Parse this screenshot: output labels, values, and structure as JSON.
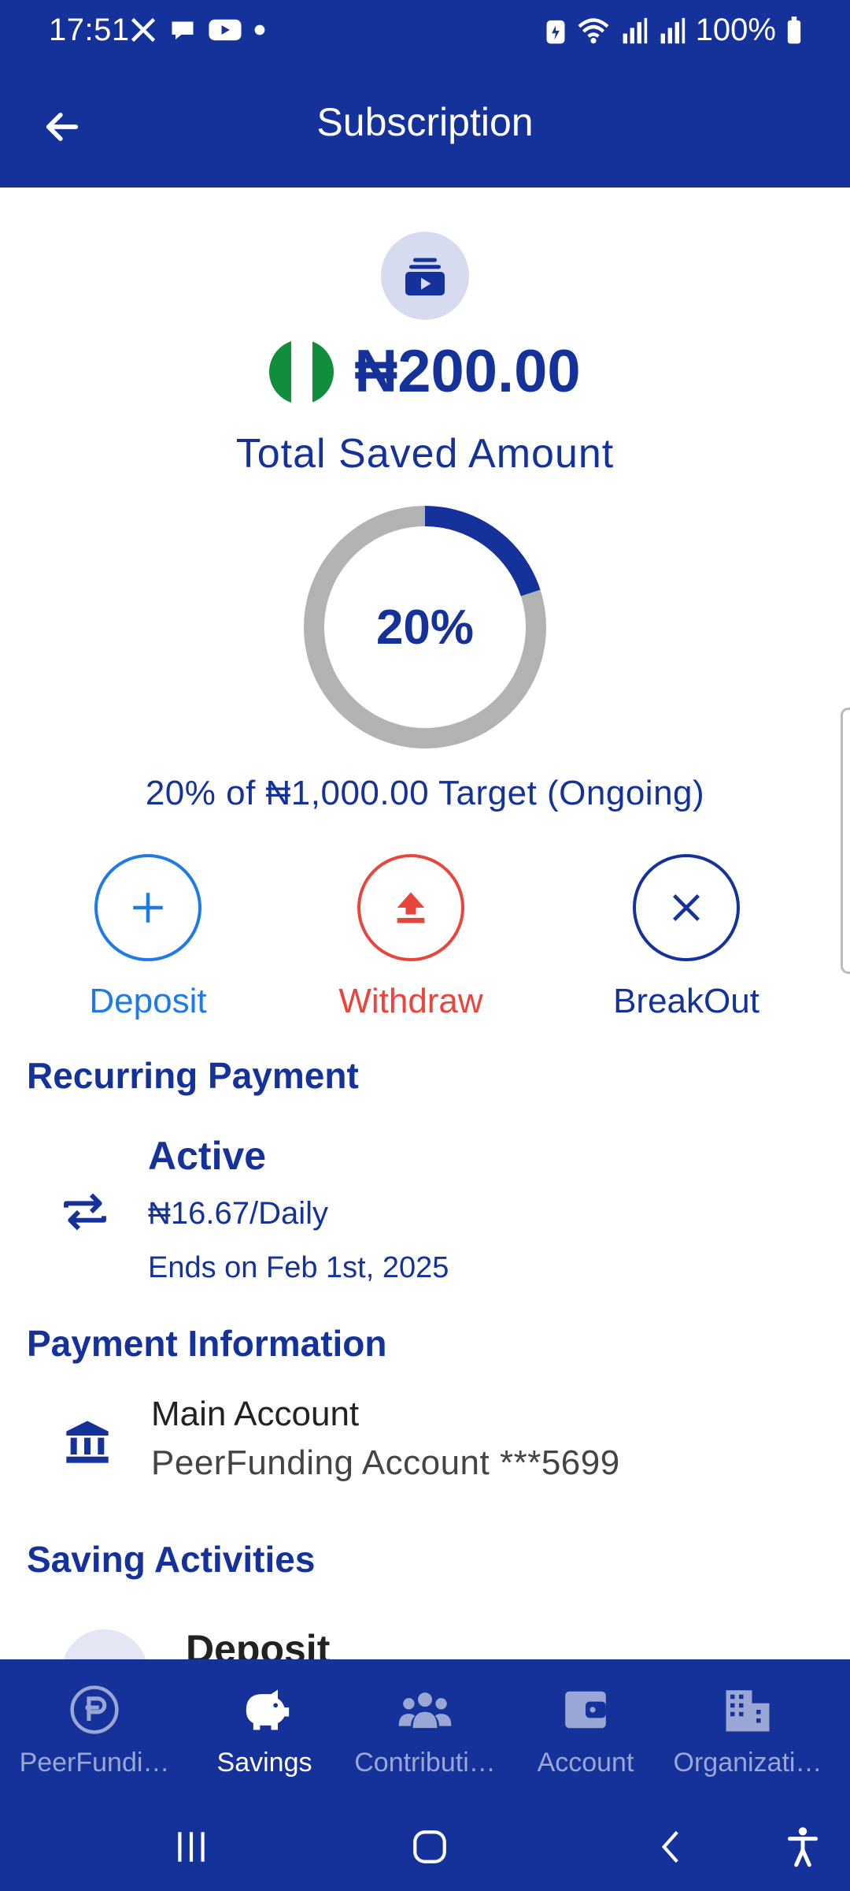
{
  "status_bar": {
    "time": "17:51",
    "battery_text": "100%",
    "left_icons": [
      "x-icon",
      "chat-icon",
      "youtube-icon",
      "dot-icon"
    ],
    "right_icons": [
      "battery-saver-icon",
      "wifi-icon",
      "signal-icon",
      "signal-icon",
      "battery-icon"
    ]
  },
  "app_bar": {
    "title": "Subscription",
    "back_icon": "arrow-left-icon"
  },
  "summary": {
    "icon": "subscription-stack-icon",
    "currency_flag": "nigeria-flag",
    "amount": "₦200.00",
    "label": "Total Saved Amount",
    "progress": {
      "percent_text": "20%",
      "fraction": 0.2,
      "fill_color": "#14329a",
      "track_color": "#b3b3b3"
    },
    "target_text": "20% of ₦1,000.00 Target (Ongoing)"
  },
  "actions": [
    {
      "label": "Deposit",
      "icon": "plus-icon",
      "color": "#1e7ae6"
    },
    {
      "label": "Withdraw",
      "icon": "upload-arrow-icon",
      "color": "#e8453c"
    },
    {
      "label": "BreakOut",
      "icon": "close-icon",
      "color": "#14329a"
    }
  ],
  "recurring_payment": {
    "heading": "Recurring Payment",
    "icon": "repeat-icon",
    "status": "Active",
    "amount": "₦16.67/Daily",
    "ends": "Ends on Feb 1st, 2025"
  },
  "payment_information": {
    "heading": "Payment Information",
    "icon": "bank-icon",
    "account_name": "Main Account",
    "account_detail": "PeerFunding Account ***5699"
  },
  "saving_activities": {
    "heading": "Saving Activities",
    "first_item_title": "Deposit"
  },
  "bottom_nav": [
    {
      "label": "PeerFundi…",
      "icon": "peerfunding-logo-icon",
      "active": false
    },
    {
      "label": "Savings",
      "icon": "piggy-bank-icon",
      "active": true
    },
    {
      "label": "Contributi…",
      "icon": "users-group-icon",
      "active": false
    },
    {
      "label": "Account",
      "icon": "wallet-icon",
      "active": false
    },
    {
      "label": "Organizati…",
      "icon": "building-icon",
      "active": false
    }
  ],
  "system_nav": [
    "recents-icon",
    "home-icon",
    "back-icon",
    "accessibility-icon"
  ],
  "colors": {
    "primary": "#14329a",
    "deposit": "#1e7ae6",
    "withdraw": "#e8453c",
    "flag_green": "#118e3b"
  }
}
